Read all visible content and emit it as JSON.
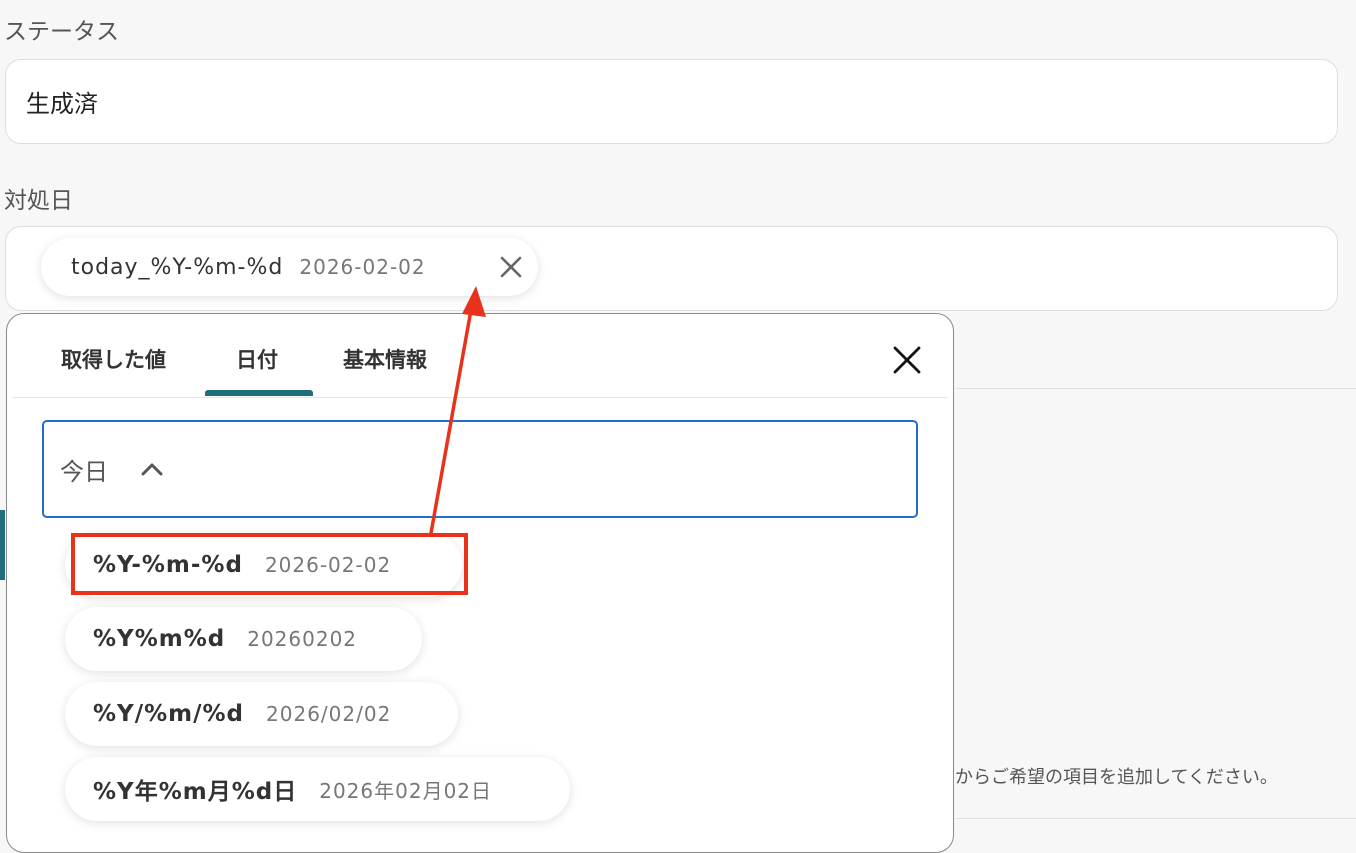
{
  "status_field": {
    "label": "ステータス",
    "value": "生成済"
  },
  "date_field": {
    "label": "対処日",
    "chip": {
      "name": "today_%Y-%m-%d",
      "value": "2026-02-02"
    }
  },
  "background": {
    "hint_text": "からご希望の項目を追加してください。"
  },
  "popup": {
    "tabs": [
      {
        "label": "取得した値"
      },
      {
        "label": "日付"
      },
      {
        "label": "基本情報"
      }
    ],
    "active_tab": "日付",
    "select_label": "今日",
    "options": [
      {
        "format": "%Y-%m-%d",
        "value": "2026-02-02"
      },
      {
        "format": "%Y%m%d",
        "value": "20260202"
      },
      {
        "format": "%Y/%m/%d",
        "value": "2026/02/02"
      },
      {
        "format": "%Y年%m月%d日",
        "value": "2026年02月02日"
      }
    ]
  },
  "colors": {
    "accent_tab": "#1f6e7c",
    "select_border": "#1e6fd0",
    "annotation_red": "#e8321c"
  }
}
